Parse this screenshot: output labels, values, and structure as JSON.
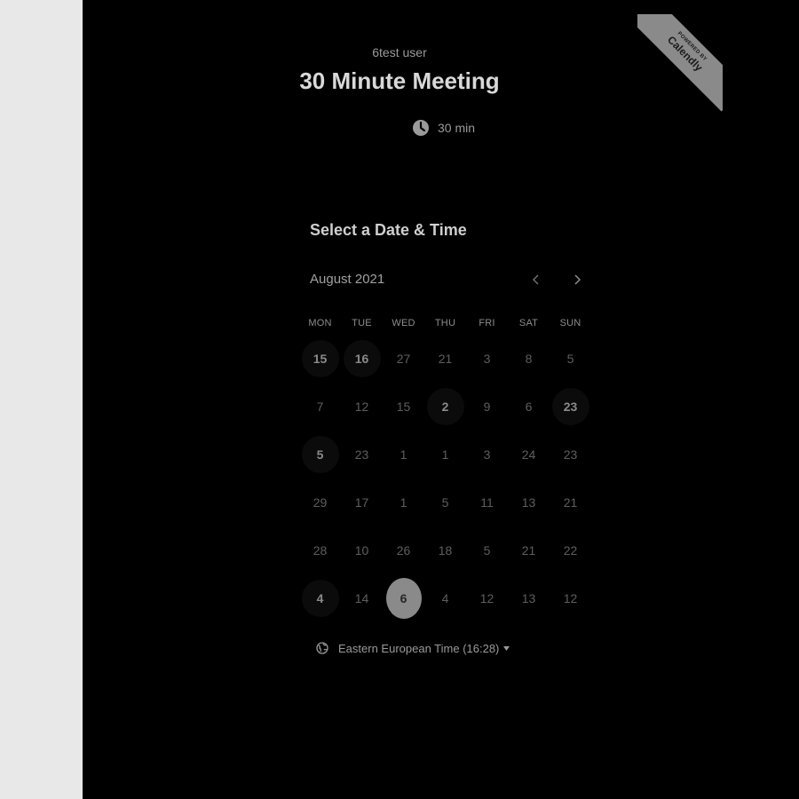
{
  "header": {
    "owner_name": "6test user",
    "event_title": "30 Minute Meeting",
    "duration": "30 min",
    "badge_top": "POWERED BY",
    "badge_brand": "Calendly"
  },
  "calendar": {
    "section_title": "Select a Date & Time",
    "month_label": "August 2021",
    "weekdays": [
      "MON",
      "TUE",
      "WED",
      "THU",
      "FRI",
      "SAT",
      "SUN"
    ],
    "rows": [
      [
        {
          "d": "15",
          "s": "available"
        },
        {
          "d": "16",
          "s": "available"
        },
        {
          "d": "27",
          "s": "off"
        },
        {
          "d": "21",
          "s": "off"
        },
        {
          "d": "3",
          "s": "off"
        },
        {
          "d": "8",
          "s": "off"
        },
        {
          "d": "5",
          "s": "off"
        }
      ],
      [
        {
          "d": "7",
          "s": "off"
        },
        {
          "d": "12",
          "s": "off"
        },
        {
          "d": "15",
          "s": "off"
        },
        {
          "d": "2",
          "s": "available"
        },
        {
          "d": "9",
          "s": "off"
        },
        {
          "d": "6",
          "s": "off"
        },
        {
          "d": "23",
          "s": "available"
        }
      ],
      [
        {
          "d": "5",
          "s": "available"
        },
        {
          "d": "23",
          "s": "off"
        },
        {
          "d": "1",
          "s": "off"
        },
        {
          "d": "1",
          "s": "off"
        },
        {
          "d": "3",
          "s": "off"
        },
        {
          "d": "24",
          "s": "off"
        },
        {
          "d": "23",
          "s": "off"
        }
      ],
      [
        {
          "d": "29",
          "s": "off"
        },
        {
          "d": "17",
          "s": "off"
        },
        {
          "d": "1",
          "s": "off"
        },
        {
          "d": "5",
          "s": "off"
        },
        {
          "d": "11",
          "s": "off"
        },
        {
          "d": "13",
          "s": "off"
        },
        {
          "d": "21",
          "s": "off"
        }
      ],
      [
        {
          "d": "28",
          "s": "off"
        },
        {
          "d": "10",
          "s": "off"
        },
        {
          "d": "26",
          "s": "off"
        },
        {
          "d": "18",
          "s": "off"
        },
        {
          "d": "5",
          "s": "off"
        },
        {
          "d": "21",
          "s": "off"
        },
        {
          "d": "22",
          "s": "off"
        }
      ],
      [
        {
          "d": "4",
          "s": "available"
        },
        {
          "d": "14",
          "s": "off"
        },
        {
          "d": "6",
          "s": "selected"
        },
        {
          "d": "4",
          "s": "off"
        },
        {
          "d": "12",
          "s": "off"
        },
        {
          "d": "13",
          "s": "off"
        },
        {
          "d": "12",
          "s": "off"
        }
      ]
    ]
  },
  "timezone": {
    "label": "Eastern European Time (16:28)"
  },
  "icons": {
    "clock": "clock-icon",
    "prev": "chevron-left-icon",
    "next": "chevron-right-icon",
    "globe": "globe-icon",
    "caret": "caret-down-icon"
  },
  "colors": {
    "background": "#000000",
    "side_strip": "#e8e8e8",
    "selected_day": "#8a8a8a",
    "badge": "#8a8a8a"
  }
}
